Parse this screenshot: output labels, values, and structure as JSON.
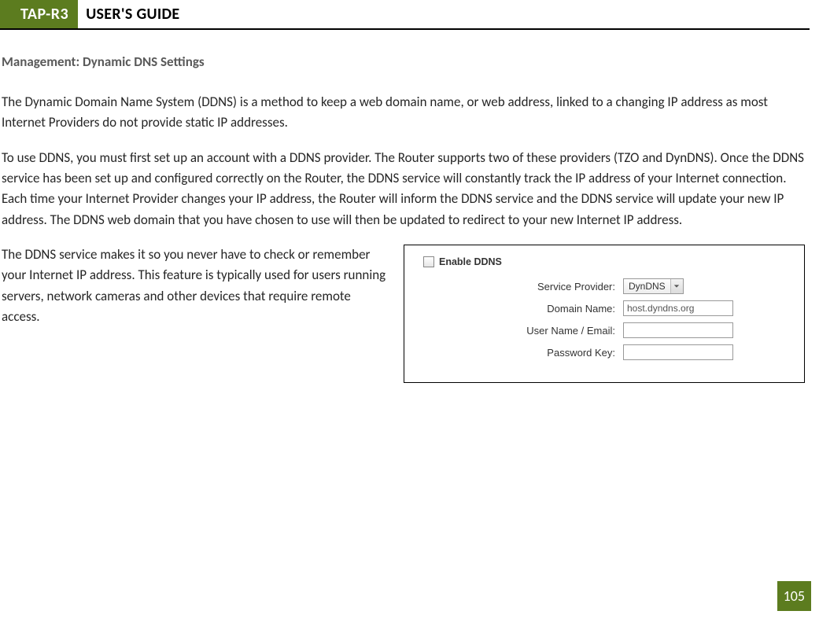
{
  "header": {
    "tag": "TAP-R3",
    "title": "USER'S GUIDE"
  },
  "section": {
    "heading": "Management: Dynamic DNS Settings"
  },
  "paragraphs": {
    "p1": "The Dynamic Domain Name System (DDNS) is a method to keep a web domain name, or web address, linked to a changing IP address as most Internet Providers do not provide static IP addresses.",
    "p2": "To use DDNS, you must first set up an account with a DDNS provider. The Router supports two of these providers (TZO and DynDNS). Once the DDNS service has been set up and configured correctly on the Router, the DDNS service will constantly track the IP address of your Internet connection. Each time your Internet Provider changes your IP address, the Router will inform the DDNS service and the DDNS service will update your new IP address.  The DDNS web domain that you have chosen to use will then be updated to redirect to your new Internet IP address.",
    "p3": "The DDNS service makes it so you never have to check or remember your Internet IP address. This feature is typically used for users running servers, network cameras and other devices that require remote access."
  },
  "settings": {
    "enable_label": "Enable DDNS",
    "provider_label": "Service Provider:",
    "provider_value": "DynDNS",
    "domain_label": "Domain Name:",
    "domain_value": "host.dyndns.org",
    "user_label": "User Name / Email:",
    "user_value": "",
    "password_label": "Password Key:",
    "password_value": ""
  },
  "page_number": "105"
}
